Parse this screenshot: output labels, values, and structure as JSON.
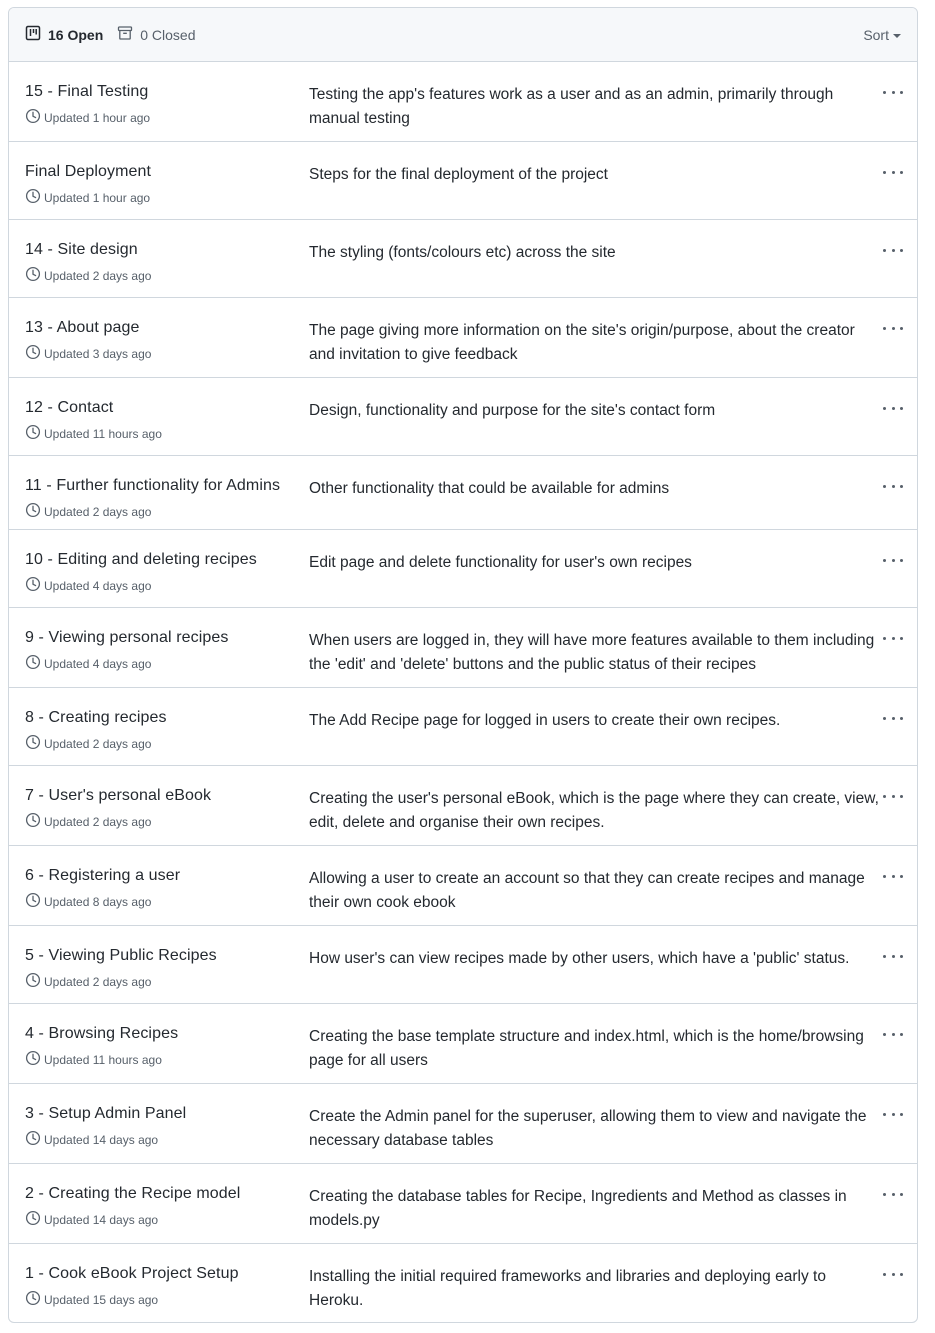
{
  "header": {
    "open_label": "16 Open",
    "closed_label": "0 Closed",
    "sort_label": "Sort"
  },
  "projects": [
    {
      "title": "15 - Final Testing",
      "updated": "Updated 1 hour ago",
      "description": "Testing the app's features work as a user and as an admin, primarily through manual testing"
    },
    {
      "title": "Final Deployment",
      "updated": "Updated 1 hour ago",
      "description": "Steps for the final deployment of the project"
    },
    {
      "title": "14 - Site design",
      "updated": "Updated 2 days ago",
      "description": "The styling (fonts/colours etc) across the site"
    },
    {
      "title": "13 - About page",
      "updated": "Updated 3 days ago",
      "description": "The page giving more information on the site's origin/purpose, about the creator and invitation to give feedback"
    },
    {
      "title": "12 - Contact",
      "updated": "Updated 11 hours ago",
      "description": "Design, functionality and purpose for the site's contact form"
    },
    {
      "title": "11 - Further functionality for Admins",
      "updated": "Updated 2 days ago",
      "description": "Other functionality that could be available for admins"
    },
    {
      "title": "10 - Editing and deleting recipes",
      "updated": "Updated 4 days ago",
      "description": "Edit page and delete functionality for user's own recipes"
    },
    {
      "title": "9 - Viewing personal recipes",
      "updated": "Updated 4 days ago",
      "description": "When users are logged in, they will have more features available to them including the 'edit' and 'delete' buttons and the public status of their recipes"
    },
    {
      "title": "8 - Creating recipes",
      "updated": "Updated 2 days ago",
      "description": "The Add Recipe page for logged in users to create their own recipes."
    },
    {
      "title": "7 - User's personal eBook",
      "updated": "Updated 2 days ago",
      "description": "Creating the user's personal eBook, which is the page where they can create, view, edit, delete and organise their own recipes."
    },
    {
      "title": "6 - Registering a user",
      "updated": "Updated 8 days ago",
      "description": "Allowing a user to create an account so that they can create recipes and manage their own cook ebook"
    },
    {
      "title": "5 - Viewing Public Recipes",
      "updated": "Updated 2 days ago",
      "description": "How user's can view recipes made by other users, which have a 'public' status."
    },
    {
      "title": "4 - Browsing Recipes",
      "updated": "Updated 11 hours ago",
      "description": "Creating the base template structure and index.html, which is the home/browsing page for all users"
    },
    {
      "title": "3 - Setup Admin Panel",
      "updated": "Updated 14 days ago",
      "description": "Create the Admin panel for the superuser, allowing them to view and navigate the necessary database tables"
    },
    {
      "title": "2 - Creating the Recipe model",
      "updated": "Updated 14 days ago",
      "description": "Creating the database tables for Recipe, Ingredients and Method as classes in models.py"
    },
    {
      "title": "1 - Cook eBook Project Setup",
      "updated": "Updated 15 days ago",
      "description": "Installing the initial required frameworks and libraries and deploying early to Heroku."
    }
  ]
}
